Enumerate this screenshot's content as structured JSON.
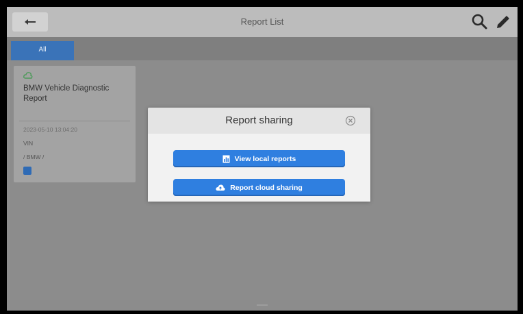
{
  "header": {
    "title": "Report List"
  },
  "tabs": [
    {
      "label": "All",
      "active": true
    }
  ],
  "report_card": {
    "title": "BMW Vehicle Diagnostic Report",
    "date": "2023-05-10 13:04:20",
    "vin": "VIN",
    "model": "/ BMW /"
  },
  "dialog": {
    "title": "Report sharing",
    "buttons": {
      "view_local": "View local reports",
      "cloud_share": "Report cloud sharing"
    }
  },
  "colors": {
    "accent": "#2f7fe0",
    "tab_active": "#3a73b8",
    "overlay": "#8c8c8c"
  },
  "icons": [
    "back-arrow-icon",
    "search-icon",
    "pencil-icon",
    "cloud-icon",
    "close-icon",
    "report-icon",
    "cloud-upload-icon"
  ]
}
